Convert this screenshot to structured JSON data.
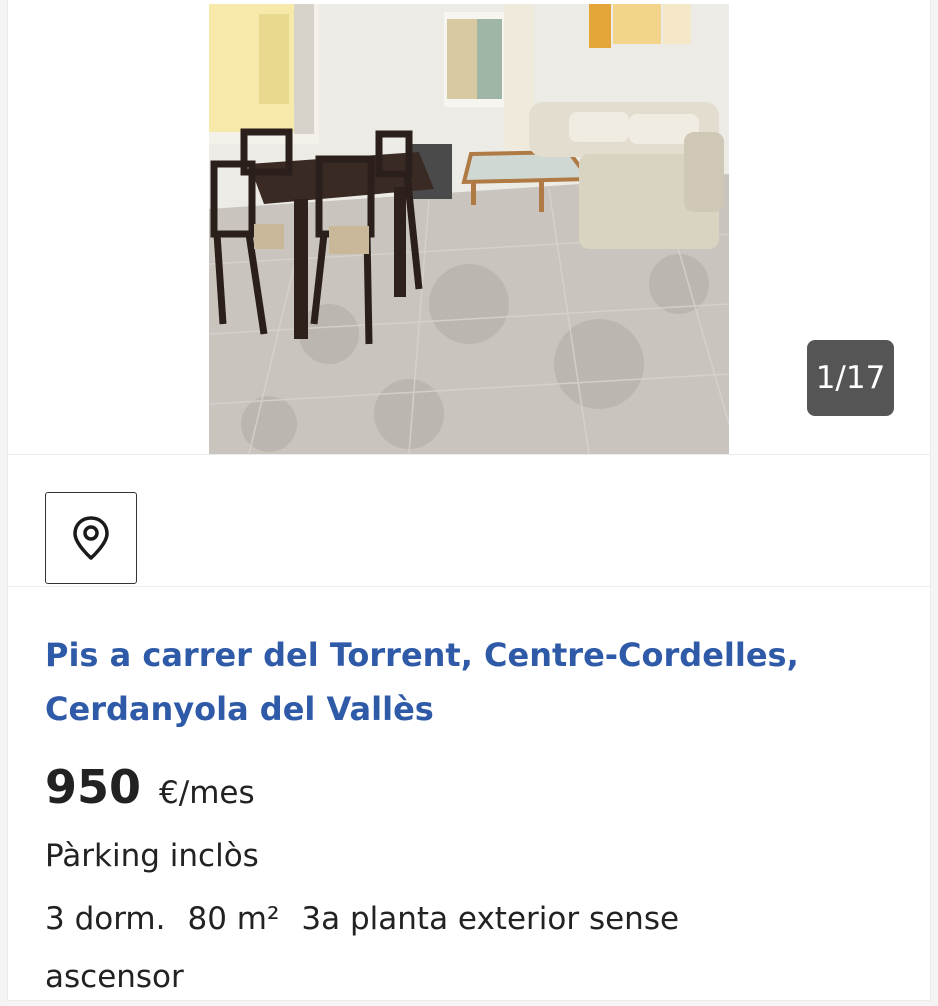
{
  "gallery": {
    "counter": "1/17",
    "photo_alt": "Living room with dining table, sofa and tiled floor"
  },
  "map_button": {
    "icon": "location-pin-icon"
  },
  "listing": {
    "title": "Pis a carrer del Torrent, Centre-Cordelles, Cerdanyola del Vallès",
    "price": "950",
    "price_unit": "€/mes",
    "feature": "Pàrking inclòs",
    "details": {
      "rooms": "3 dorm.",
      "area": "80 m²",
      "floor": "3a planta exterior sense ascensor"
    }
  },
  "colors": {
    "title": "#2e5aa8",
    "counter_bg": "#555555",
    "text": "#222222"
  }
}
